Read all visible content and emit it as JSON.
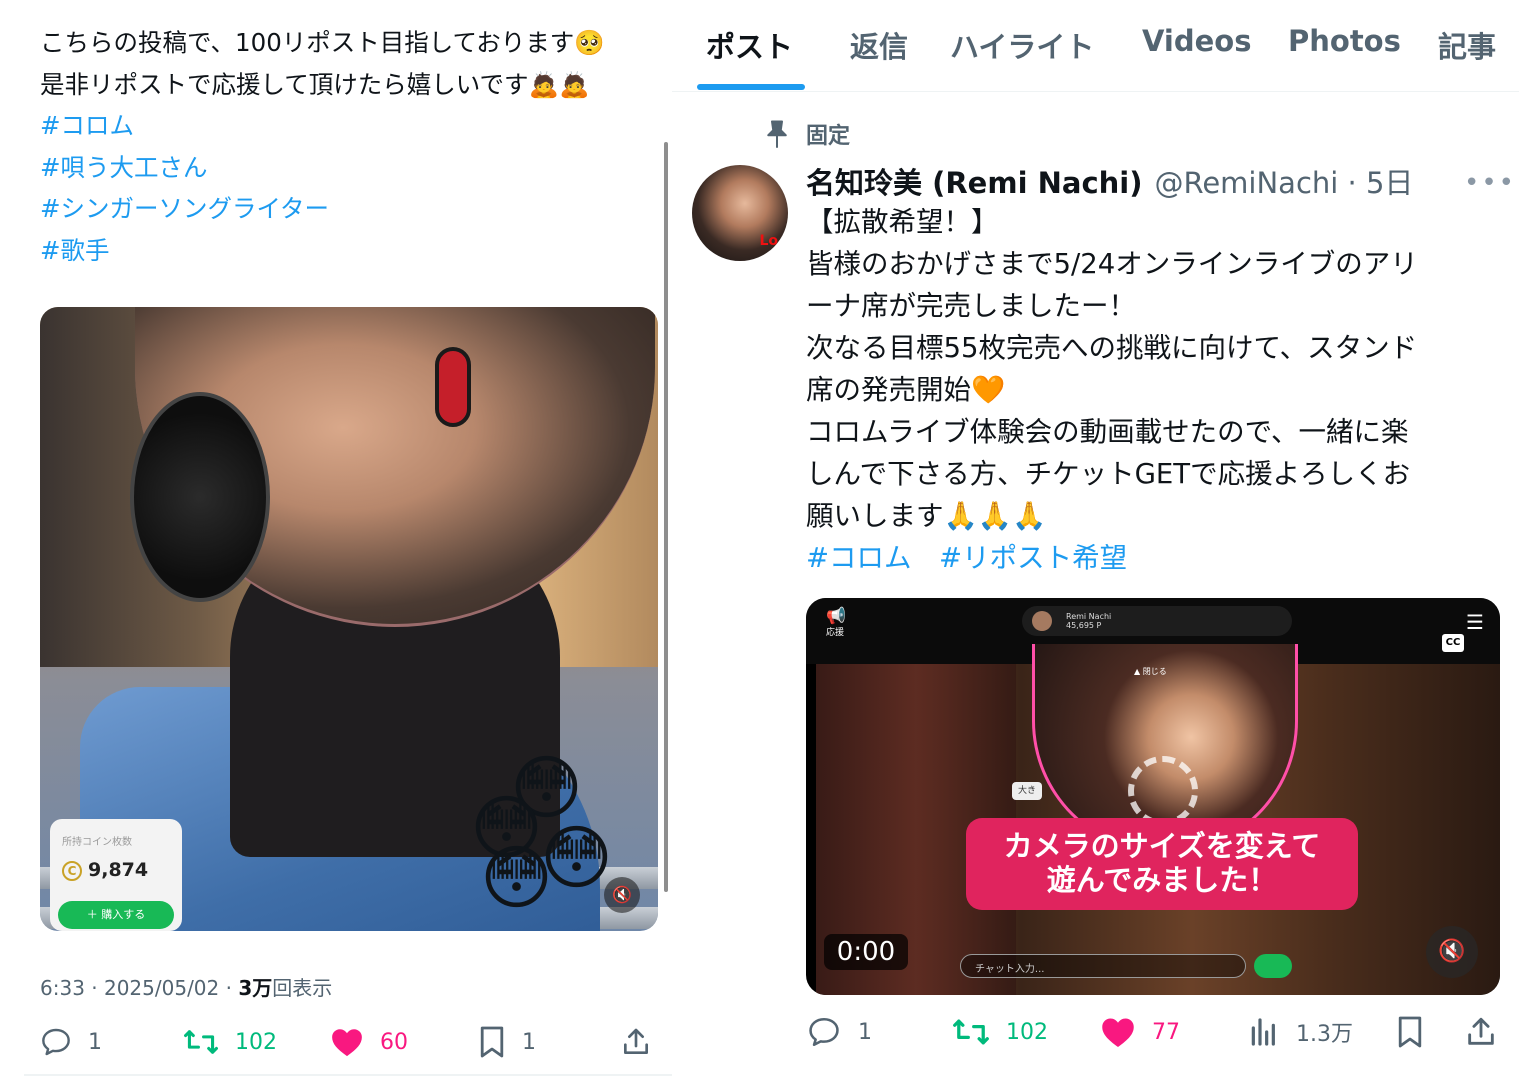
{
  "left_post": {
    "text_lines": [
      "こちらの投稿で、100リポスト目指しております🥺",
      "是非リポストで応援して頂けたら嬉しいです🙇🙇"
    ],
    "hashtags": [
      "#コロム",
      "#唄う大工さん",
      "#シンガーソングライター",
      "#歌手"
    ],
    "media": {
      "coin_caption": "所持コイン枚数",
      "coin_value": "9,874",
      "buy_label": "＋ 購入する"
    },
    "meta": {
      "time_date": "6:33 · 2025/05/02 · ",
      "views_number": "3万",
      "views_label": "回表示"
    },
    "actions": {
      "replies": "1",
      "reposts": "102",
      "likes": "60",
      "bookmarks": "1"
    }
  },
  "right_profile": {
    "tabs": [
      "ポスト",
      "返信",
      "ハイライト",
      "Videos",
      "Photos",
      "記事"
    ],
    "active_tab": "ポスト",
    "pinned_label": "固定",
    "post": {
      "display_name": "名知玲美 (Remi Nachi)",
      "handle_time": "@RemiNachi · 5日",
      "avatar_mark": "Lo",
      "text_lines": [
        "【拡散希望！】",
        "皆様のおかげさまで5/24オンラインライブのアリ",
        "ーナ席が完売しましたー！",
        "次なる目標55枚完売への挑戦に向けて、スタンド",
        "席の発売開始🧡",
        "コロムライブ体験会の動画載せたので、一緒に楽",
        "しんで下さる方、チケットGETで応援よろしくお",
        "願いします🙏🙏🙏"
      ],
      "hashtags_line": "#コロム　#リポスト希望",
      "video": {
        "top_label": "応援",
        "channel_name": "Remi Nachi",
        "channel_points": "45,695 P",
        "cc_label": "CC",
        "close_label": "▲ 閉じる",
        "size_label": "大き",
        "banner_line1": "カメラのサイズを変えて",
        "banner_line2": "遊んでみました！",
        "chat_placeholder": "チャット入力...",
        "time": "0:00"
      },
      "actions": {
        "replies": "1",
        "reposts": "102",
        "likes": "77",
        "views": "1.3万"
      }
    }
  },
  "colors": {
    "link_blue": "#1d9bf0",
    "repost_green": "#00ba7c",
    "like_pink": "#f91880",
    "muted_gray": "#536471",
    "banner_red": "#e0245e"
  },
  "icons": [
    "reply-icon",
    "repost-icon",
    "heart-icon",
    "bookmark-icon",
    "share-icon",
    "views-icon",
    "pin-icon",
    "more-icon",
    "mute-icon"
  ]
}
